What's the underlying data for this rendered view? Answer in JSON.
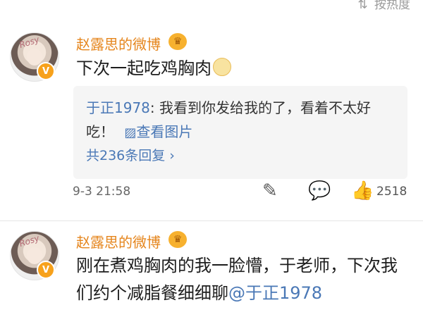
{
  "topbar": {
    "sort_icon": "sort-icon",
    "sort_label": "按热度"
  },
  "posts": [
    {
      "name": "赵露思的微博",
      "avatar_text": "Rosy",
      "content": "下次一起吃鸡胸肉",
      "reply": {
        "author": "于正1978",
        "separator": ":",
        "text_line1": " 我看到你发给我的了，看着不太好",
        "text_line2": "吃！",
        "image_link": "查看图片",
        "count_link": "共236条回复 ›"
      },
      "time": "9-3 21:58",
      "likes": "2518"
    },
    {
      "name": "赵露思的微博",
      "avatar_text": "Rosy",
      "content_line1": "刚在煮鸡胸肉的我一脸懵，于老师，下次我",
      "content_line2_text": "们约个减脂餐细细聊",
      "mention": "@于正1978"
    }
  ]
}
